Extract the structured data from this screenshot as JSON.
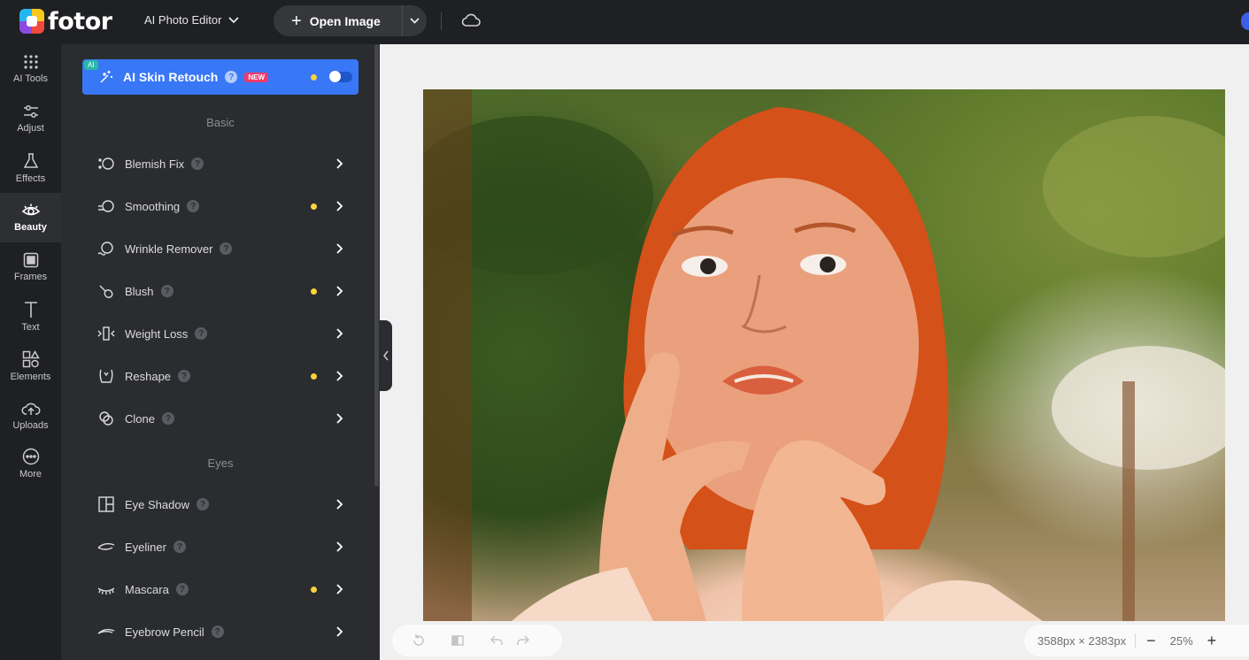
{
  "header": {
    "brand": "fotor",
    "app_select": "AI Photo Editor",
    "open_image": "Open Image"
  },
  "nav": [
    {
      "label": "AI Tools",
      "icon": "grid-dots-icon"
    },
    {
      "label": "Adjust",
      "icon": "sliders-icon"
    },
    {
      "label": "Effects",
      "icon": "flask-icon"
    },
    {
      "label": "Beauty",
      "icon": "eye-icon",
      "active": true
    },
    {
      "label": "Frames",
      "icon": "frame-icon"
    },
    {
      "label": "Text",
      "icon": "text-icon"
    },
    {
      "label": "Elements",
      "icon": "shapes-icon"
    },
    {
      "label": "Uploads",
      "icon": "cloud-upload-icon"
    },
    {
      "label": "More",
      "icon": "more-icon"
    }
  ],
  "panel": {
    "ai_skin": {
      "badge": "AI",
      "label": "AI Skin Retouch",
      "help": "?",
      "new_badge": "NEW",
      "enabled": false
    },
    "section_basic": "Basic",
    "section_eyes": "Eyes",
    "tools": [
      {
        "label": "Blemish Fix",
        "help": "?",
        "modified": false
      },
      {
        "label": "Smoothing",
        "help": "?",
        "modified": true
      },
      {
        "label": "Wrinkle Remover",
        "help": "?",
        "modified": false
      },
      {
        "label": "Blush",
        "help": "?",
        "modified": true
      },
      {
        "label": "Weight Loss",
        "help": "?",
        "modified": false
      },
      {
        "label": "Reshape",
        "help": "?",
        "modified": true
      },
      {
        "label": "Clone",
        "help": "?",
        "modified": false
      }
    ],
    "eye_tools": [
      {
        "label": "Eye Shadow",
        "help": "?",
        "modified": false
      },
      {
        "label": "Eyeliner",
        "help": "?",
        "modified": false
      },
      {
        "label": "Mascara",
        "help": "?",
        "modified": true
      },
      {
        "label": "Eyebrow Pencil",
        "help": "?",
        "modified": false
      }
    ]
  },
  "canvas": {
    "dimensions": "3588px × 2383px",
    "zoom": "25%",
    "zoom_minus": "−",
    "zoom_plus": "+"
  },
  "colors": {
    "accent": "#3877f6",
    "modified_dot": "#f9d33a",
    "new_badge": "#f33a6a",
    "panel_bg": "#2b2c30",
    "topbar_bg": "#1f2023"
  }
}
